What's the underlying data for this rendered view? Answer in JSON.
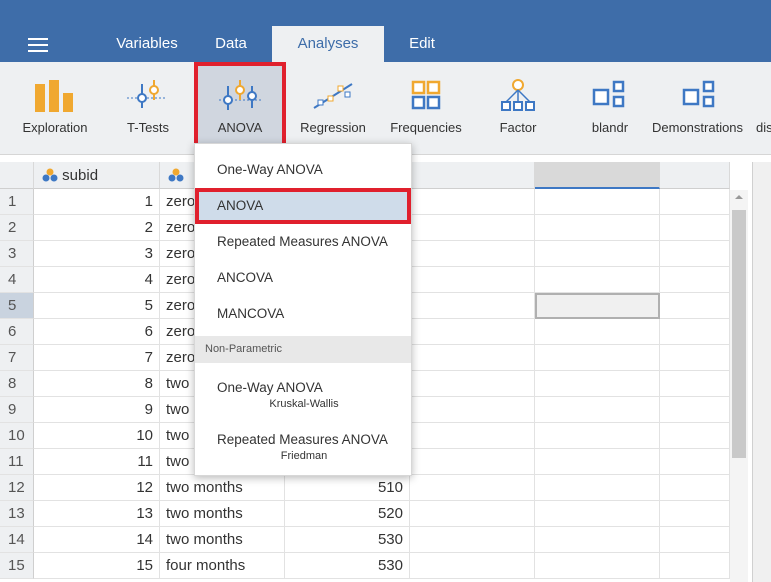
{
  "tabs": [
    "Variables",
    "Data",
    "Analyses",
    "Edit"
  ],
  "ribbon": [
    {
      "label": "Exploration",
      "icon": "exploration-icon"
    },
    {
      "label": "T-Tests",
      "icon": "ttests-icon"
    },
    {
      "label": "ANOVA",
      "icon": "anova-icon"
    },
    {
      "label": "Regression",
      "icon": "regression-icon"
    },
    {
      "label": "Frequencies",
      "icon": "frequencies-icon"
    },
    {
      "label": "Factor",
      "icon": "factor-icon"
    },
    {
      "label": "blandr",
      "icon": "module-icon"
    },
    {
      "label": "Demonstrations",
      "icon": "module-icon"
    },
    {
      "label": "dis",
      "icon": "module-icon"
    }
  ],
  "grid": {
    "col1_header": "subid",
    "rows": [
      {
        "n": "1",
        "subid": "1",
        "group": "zero",
        "value": ""
      },
      {
        "n": "2",
        "subid": "2",
        "group": "zero",
        "value": ""
      },
      {
        "n": "3",
        "subid": "3",
        "group": "zero",
        "value": ""
      },
      {
        "n": "4",
        "subid": "4",
        "group": "zero",
        "value": ""
      },
      {
        "n": "5",
        "subid": "5",
        "group": "zero",
        "value": ""
      },
      {
        "n": "6",
        "subid": "6",
        "group": "zero",
        "value": ""
      },
      {
        "n": "7",
        "subid": "7",
        "group": "zero",
        "value": ""
      },
      {
        "n": "8",
        "subid": "8",
        "group": "two",
        "value": ""
      },
      {
        "n": "9",
        "subid": "9",
        "group": "two",
        "value": ""
      },
      {
        "n": "10",
        "subid": "10",
        "group": "two",
        "value": ""
      },
      {
        "n": "11",
        "subid": "11",
        "group": "two",
        "value": ""
      },
      {
        "n": "12",
        "subid": "12",
        "group": "two months",
        "value": "510"
      },
      {
        "n": "13",
        "subid": "13",
        "group": "two months",
        "value": "520"
      },
      {
        "n": "14",
        "subid": "14",
        "group": "two months",
        "value": "530"
      },
      {
        "n": "15",
        "subid": "15",
        "group": "four months",
        "value": "530"
      }
    ]
  },
  "menu": {
    "items": [
      "One-Way ANOVA",
      "ANOVA",
      "Repeated Measures ANOVA",
      "ANCOVA",
      "MANCOVA"
    ],
    "section": "Non-Parametric",
    "np_items": [
      {
        "label": "One-Way ANOVA",
        "sub": "Kruskal-Wallis"
      },
      {
        "label": "Repeated Measures ANOVA",
        "sub": "Friedman"
      }
    ]
  },
  "colors": {
    "topbar": "#3e6da9",
    "highlight_border": "#e0202d",
    "icon_orange": "#f0a830",
    "icon_blue": "#3e78c4"
  }
}
